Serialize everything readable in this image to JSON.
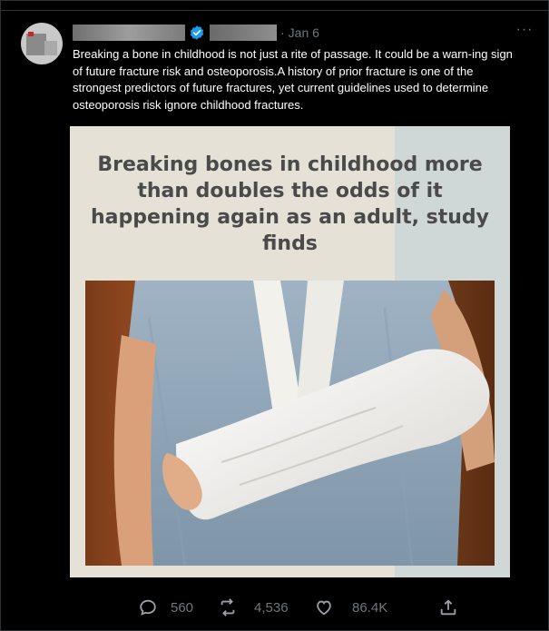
{
  "tweet": {
    "date": "Jan 6",
    "separator": "·",
    "more_label": "···",
    "text": "Breaking a bone in childhood is not just a rite of passage. It could be a warn-ing sign of future fracture risk and osteoporosis.A history of prior fracture is one of the strongest predictors of future fractures, yet current guidelines used to determine osteoporosis risk ignore childhood fractures.",
    "media": {
      "headline": "Breaking bones in childhood more than doubles the odds of it happening again as an adult, study finds"
    },
    "actions": {
      "replies": "560",
      "reposts": "4,536",
      "likes": "86.4K"
    }
  },
  "icons": {
    "verified": "verified-badge-icon",
    "reply": "reply-icon",
    "repost": "repost-icon",
    "like": "heart-icon",
    "share": "share-icon"
  },
  "colors": {
    "background": "#000000",
    "accent": "#1d9bf0",
    "muted": "#71767b"
  }
}
